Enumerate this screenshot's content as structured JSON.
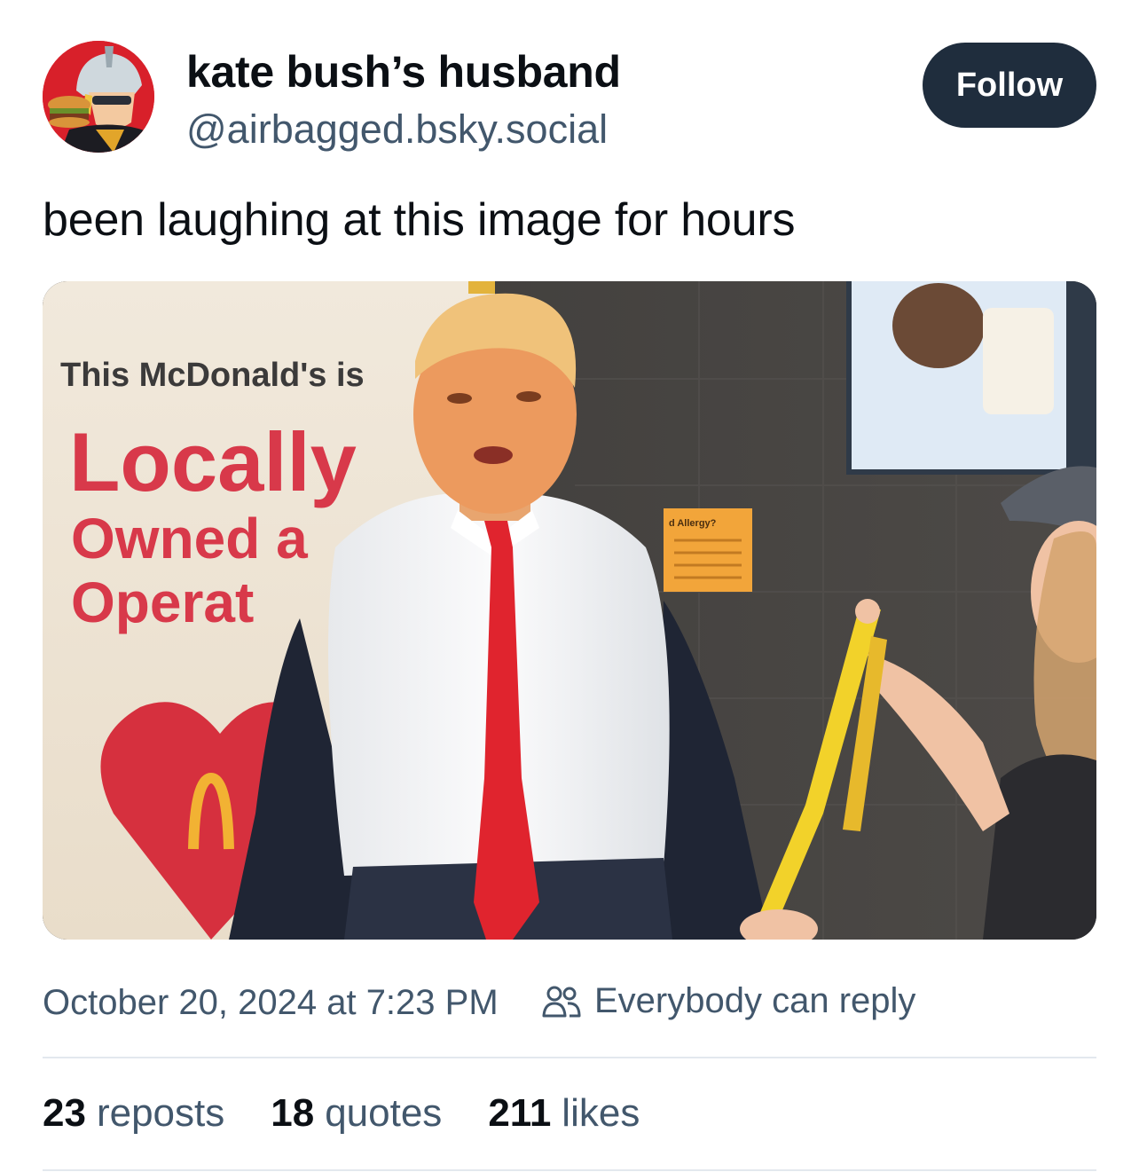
{
  "author": {
    "display_name": "kate bush’s husband",
    "handle": "@airbagged.bsky.social",
    "avatar_icon": "user-avatar"
  },
  "follow_label": "Follow",
  "post": {
    "text": "been laughing at this image for hours",
    "image": {
      "sign_line1": "This McDonald's is",
      "sign_line2": "Locally",
      "sign_line3": "Owned a",
      "sign_line4": "Operat",
      "notice_text": "d Allergy?"
    }
  },
  "meta": {
    "timestamp": "October 20, 2024 at 7:23 PM",
    "reply_setting": "Everybody can reply",
    "reply_icon": "people-icon"
  },
  "stats": {
    "reposts_count": "23",
    "reposts_label": "reposts",
    "quotes_count": "18",
    "quotes_label": "quotes",
    "likes_count": "211",
    "likes_label": "likes"
  },
  "colors": {
    "follow_bg": "#1f2d3d",
    "muted_text": "#42576c",
    "sign_red": "#d8394a",
    "tie_red": "#e0242e",
    "strap_yellow": "#f2d22a"
  }
}
